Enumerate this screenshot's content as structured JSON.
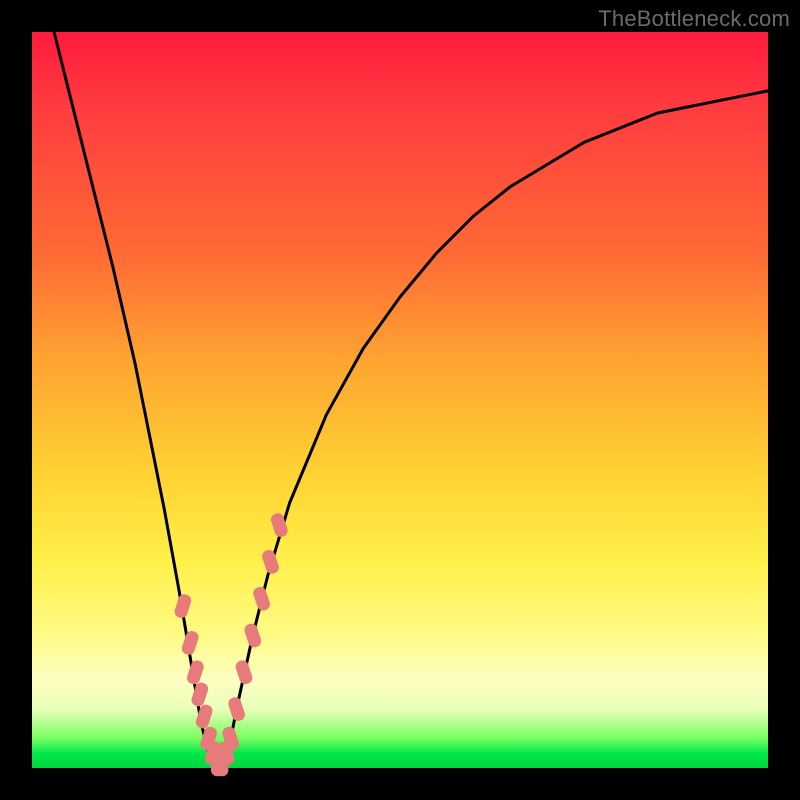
{
  "watermark": "TheBottleneck.com",
  "colors": {
    "frame": "#000000",
    "curve": "#000000",
    "marker_fill": "#e77a7a",
    "marker_stroke": "#d86868"
  },
  "chart_data": {
    "type": "line",
    "title": "",
    "xlabel": "",
    "ylabel": "",
    "xlim": [
      0,
      100
    ],
    "ylim": [
      0,
      100
    ],
    "notes": "V-shaped bottleneck curve. Y≈0 is optimal (green band); Y toward 100 is worst (red). Minimum is near x≈25. No numeric axis ticks are rendered.",
    "series": [
      {
        "name": "bottleneck-curve",
        "x": [
          3,
          5,
          8,
          11,
          14,
          16,
          18,
          20,
          21,
          22,
          23,
          24,
          25,
          26,
          27,
          28,
          30,
          32,
          35,
          40,
          45,
          50,
          55,
          60,
          65,
          70,
          75,
          80,
          85,
          90,
          95,
          100
        ],
        "y": [
          100,
          92,
          80,
          68,
          55,
          45,
          35,
          24,
          18,
          12,
          6,
          2,
          0,
          1,
          4,
          9,
          18,
          26,
          36,
          48,
          57,
          64,
          70,
          75,
          79,
          82,
          85,
          87,
          89,
          90,
          91,
          92
        ]
      }
    ],
    "markers": {
      "name": "near-optimal-points",
      "x": [
        20.5,
        21.5,
        22.2,
        22.8,
        23.4,
        24.0,
        24.6,
        25.2,
        25.8,
        26.4,
        27.0,
        27.8,
        28.8,
        30.0,
        31.2,
        32.4,
        33.6
      ],
      "y": [
        22,
        17,
        13,
        10,
        7,
        4,
        2,
        0.5,
        0.5,
        2,
        4,
        8,
        13,
        18,
        23,
        28,
        33
      ]
    }
  }
}
